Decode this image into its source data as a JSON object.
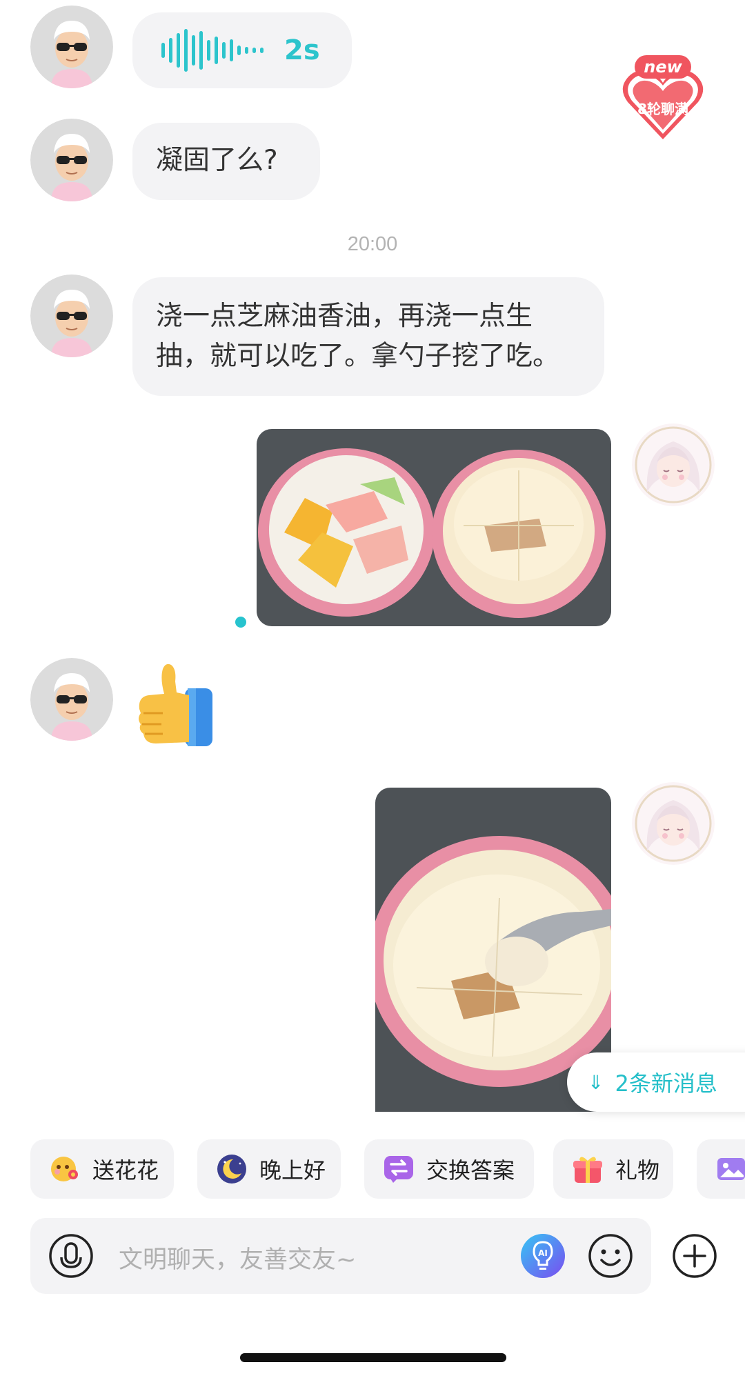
{
  "messages": {
    "voice": {
      "duration": "2s"
    },
    "text_1": "凝固了么?",
    "timestamp": "20:00",
    "text_2": "浇一点芝麻油香油，再浇一点生抽，就可以吃了。拿勺子挖了吃。"
  },
  "badge": {
    "label": "new",
    "heart_text": "8轮聊满"
  },
  "new_messages": {
    "label": "2条新消息"
  },
  "quick_replies": [
    {
      "label": "送花花",
      "icon": "flower-emoji-icon"
    },
    {
      "label": "晚上好",
      "icon": "moon-icon"
    },
    {
      "label": "交换答案",
      "icon": "exchange-icon"
    },
    {
      "label": "礼物",
      "icon": "gift-icon"
    }
  ],
  "input": {
    "placeholder": "文明聊天，友善交友~"
  },
  "colors": {
    "accent": "#2cc4cc",
    "bubble": "#f3f3f5",
    "badge_red": "#f0555f"
  }
}
